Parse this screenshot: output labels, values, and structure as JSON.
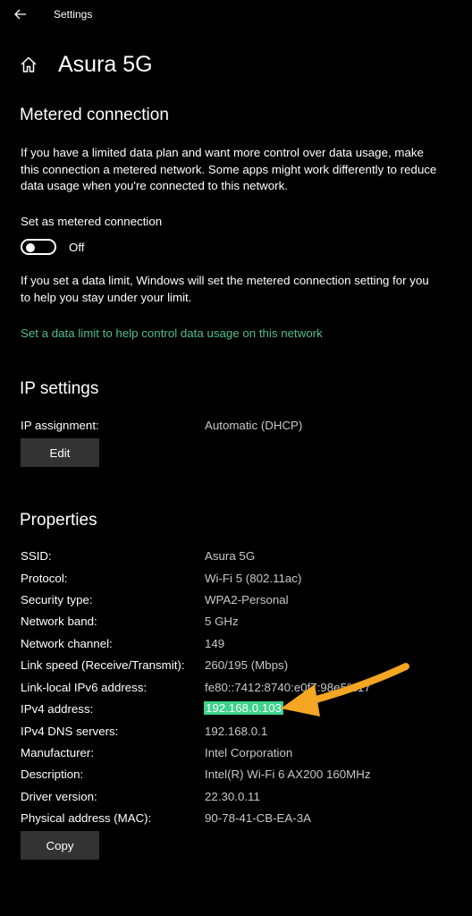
{
  "app": {
    "title": "Settings"
  },
  "page": {
    "title": "Asura 5G"
  },
  "metered": {
    "heading": "Metered connection",
    "description": "If you have a limited data plan and want more control over data usage, make this connection a metered network. Some apps might work differently to reduce data usage when you're connected to this network.",
    "toggle_label": "Set as metered connection",
    "toggle_state": "Off",
    "limit_note": "If you set a data limit, Windows will set the metered connection setting for you to help you stay under your limit.",
    "limit_link": "Set a data limit to help control data usage on this network"
  },
  "ip": {
    "heading": "IP settings",
    "assignment_label": "IP assignment:",
    "assignment_value": "Automatic (DHCP)",
    "edit_label": "Edit"
  },
  "properties": {
    "heading": "Properties",
    "rows": [
      {
        "key": "SSID:",
        "value": "Asura 5G"
      },
      {
        "key": "Protocol:",
        "value": "Wi-Fi 5 (802.11ac)"
      },
      {
        "key": "Security type:",
        "value": "WPA2-Personal"
      },
      {
        "key": "Network band:",
        "value": "5 GHz"
      },
      {
        "key": "Network channel:",
        "value": "149"
      },
      {
        "key": "Link speed (Receive/Transmit):",
        "value": "260/195 (Mbps)"
      },
      {
        "key": "Link-local IPv6 address:",
        "value": "fe80::7412:8740:e0f7:98e5%17"
      },
      {
        "key": "IPv4 address:",
        "value": "192.168.0.103"
      },
      {
        "key": "IPv4 DNS servers:",
        "value": "192.168.0.1"
      },
      {
        "key": "Manufacturer:",
        "value": "Intel Corporation"
      },
      {
        "key": "Description:",
        "value": "Intel(R) Wi-Fi 6 AX200 160MHz"
      },
      {
        "key": "Driver version:",
        "value": "22.30.0.11"
      },
      {
        "key": "Physical address (MAC):",
        "value": "90-78-41-CB-EA-3A"
      }
    ],
    "copy_label": "Copy"
  },
  "colors": {
    "link": "#4fbf8a",
    "highlight": "#3ed38c",
    "arrow": "#f5a623"
  }
}
